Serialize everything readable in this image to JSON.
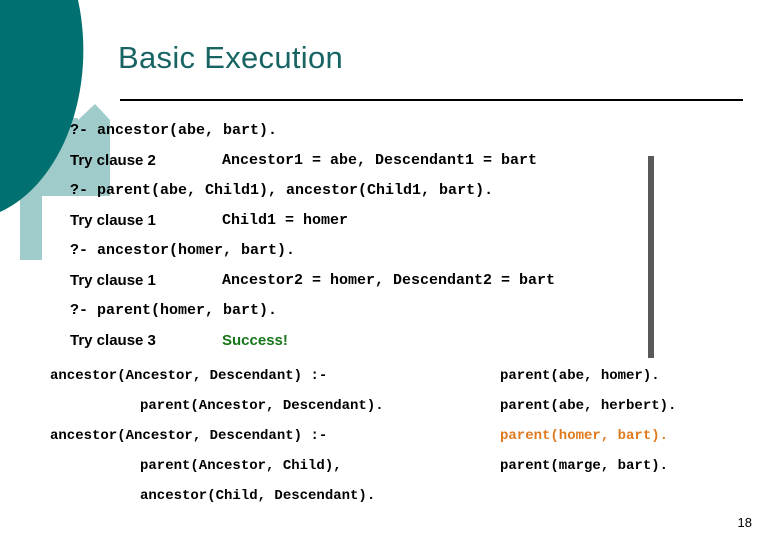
{
  "slide": {
    "title": "Basic Execution",
    "page_number": "18",
    "accent_color": "#186463",
    "success_color": "#17761a",
    "highlight_color": "#df7a1e",
    "divider_color": "#595959",
    "deco_dark_color": "#017070",
    "deco_light_color": "#9fcccb"
  },
  "trace": {
    "rows": [
      {
        "kind": "query",
        "query": "?- ancestor(abe, bart)."
      },
      {
        "kind": "clause",
        "label": "Try clause 2",
        "value": "Ancestor1 = abe, Descendant1 = bart",
        "value_status": "normal"
      },
      {
        "kind": "query",
        "query": "?- parent(abe, Child1), ancestor(Child1, bart)."
      },
      {
        "kind": "clause",
        "label": "Try clause 1",
        "value": "Child1 = homer",
        "value_status": "normal"
      },
      {
        "kind": "query",
        "query": "?- ancestor(homer, bart)."
      },
      {
        "kind": "clause",
        "label": "Try clause 1",
        "value": "Ancestor2 = homer, Descendant2 = bart",
        "value_status": "normal"
      },
      {
        "kind": "query",
        "query": "?- parent(homer, bart)."
      },
      {
        "kind": "clause",
        "label": "Try clause 3",
        "value": "Success!",
        "value_status": "success"
      }
    ]
  },
  "program": {
    "left_lines": [
      {
        "text": "ancestor(Ancestor, Descendant) :-",
        "indent": false,
        "highlight": false
      },
      {
        "text": "parent(Ancestor, Descendant).",
        "indent": true,
        "highlight": false
      },
      {
        "text": "ancestor(Ancestor, Descendant) :-",
        "indent": false,
        "highlight": false
      },
      {
        "text": "parent(Ancestor, Child),",
        "indent": true,
        "highlight": false
      },
      {
        "text": "ancestor(Child, Descendant).",
        "indent": true,
        "highlight": false
      }
    ],
    "right_lines": [
      {
        "text": "parent(abe, homer).",
        "highlight": false
      },
      {
        "text": "parent(abe, herbert).",
        "highlight": false
      },
      {
        "text": "parent(homer, bart).",
        "highlight": true
      },
      {
        "text": "parent(marge, bart).",
        "highlight": false
      },
      {
        "text": "",
        "highlight": false
      }
    ]
  }
}
